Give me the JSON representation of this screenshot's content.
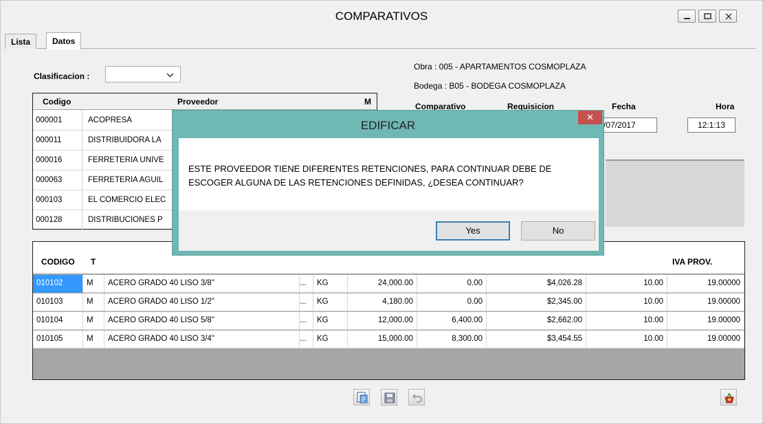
{
  "window": {
    "title": "COMPARATIVOS",
    "controls": [
      "minimize-icon",
      "maximize-icon",
      "close-icon"
    ]
  },
  "tabs": [
    {
      "label": "Lista"
    },
    {
      "label": "Datos",
      "active": true
    }
  ],
  "clasificacion": {
    "label": "Clasificacion :",
    "value": ""
  },
  "obra": "Obra : 005 - APARTAMENTOS COSMOPLAZA",
  "bodega": "Bodega : B05 - BODEGA COSMOPLAZA",
  "header_fields": {
    "comparativo_label": "Comparativo",
    "requisicion_label": "Requisicion",
    "fecha_label": "Fecha",
    "fecha_value": "/07/2017",
    "hora_label": "Hora",
    "hora_value": "12:1:13"
  },
  "proveedores": {
    "columns": [
      "Codigo",
      "Proveedor",
      "M"
    ],
    "rows": [
      {
        "codigo": "000001",
        "proveedor": "ACOPRESA"
      },
      {
        "codigo": "000011",
        "proveedor": "DISTRIBUIDORA LA"
      },
      {
        "codigo": "000016",
        "proveedor": "FERRETERIA UNIVE"
      },
      {
        "codigo": "000063",
        "proveedor": "FERRETERIA AGUIL"
      },
      {
        "codigo": "000103",
        "proveedor": "EL COMERCIO ELEC"
      },
      {
        "codigo": "000128",
        "proveedor": "DISTRIBUCIONES P"
      }
    ]
  },
  "items": {
    "columns": [
      "CODIGO",
      "T",
      "",
      "",
      "",
      "",
      "",
      "",
      "IVA PROV."
    ],
    "rows": [
      {
        "codigo": "010102",
        "t": "M",
        "recurso": "ACERO GRADO 40 LISO  3/8\"",
        "dots": "...",
        "und": "KG",
        "requerida": "24,000.00",
        "comprada": "0.00",
        "valor": "$4,026.28",
        "desc": "10.00",
        "iva": "19.00000"
      },
      {
        "codigo": "010103",
        "t": "M",
        "recurso": "ACERO GRADO 40 LISO  1/2\"",
        "dots": "...",
        "und": "KG",
        "requerida": "4,180.00",
        "comprada": "0.00",
        "valor": "$2,345.00",
        "desc": "10.00",
        "iva": "19.00000"
      },
      {
        "codigo": "010104",
        "t": "M",
        "recurso": "ACERO GRADO 40 LISO  5/8\"",
        "dots": "...",
        "und": "KG",
        "requerida": "12,000.00",
        "comprada": "6,400.00",
        "valor": "$2,662.00",
        "desc": "10.00",
        "iva": "19.00000"
      },
      {
        "codigo": "010105",
        "t": "M",
        "recurso": "ACERO GRADO 40 LISO  3/4\"",
        "dots": "...",
        "und": "KG",
        "requerida": "15,000.00",
        "comprada": "8,300.00",
        "valor": "$3,454.55",
        "desc": "10.00",
        "iva": "19.00000"
      }
    ]
  },
  "toolbar": {
    "icons": [
      "report-icon",
      "save-icon",
      "undo-icon",
      "basket-icon"
    ]
  },
  "dialog": {
    "title": "EDIFICAR",
    "close_label": "✕",
    "message": "ESTE PROVEEDOR TIENE DIFERENTES RETENCIONES, PARA CONTINUAR DEBE DE ESCOGER ALGUNA DE LAS RETENCIONES DEFINIDAS, ¿DESEA CONTINUAR?",
    "yes_label": "Yes",
    "no_label": "No"
  },
  "colors": {
    "dialog_frame": "#6fb8b4",
    "selection": "#3399ff",
    "close_button": "#c75050"
  }
}
